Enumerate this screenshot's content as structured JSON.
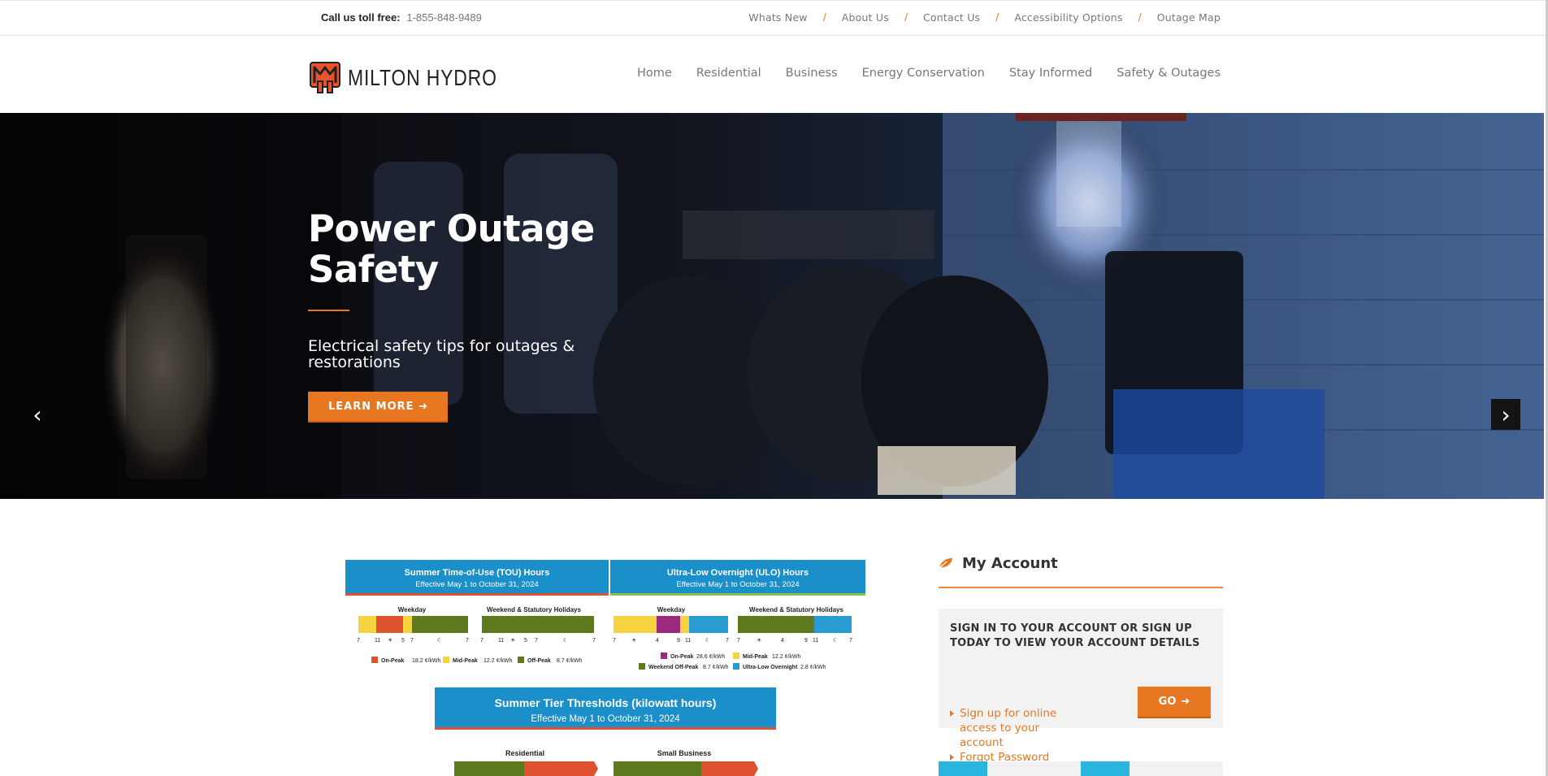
{
  "topbar": {
    "call_label": "Call us toll free:",
    "phone": "1-855-848-9489",
    "links": [
      "Whats New",
      "About Us",
      "Contact Us",
      "Accessibility Options",
      "Outage Map"
    ],
    "separator": "/"
  },
  "header": {
    "logo_text": "MILTON HYDRO",
    "nav": [
      "Home",
      "Residential",
      "Business",
      "Energy Conservation",
      "Stay Informed",
      "Safety & Outages"
    ]
  },
  "hero": {
    "title_line1": "Power Outage",
    "title_line2": "Safety",
    "subtitle": "Electrical safety tips for outages & restorations",
    "button_label": "LEARN MORE",
    "prev_icon": "‹",
    "next_icon": "›"
  },
  "rates": {
    "tou_title": "Summer Time-of-Use (TOU) Hours",
    "tou_sub": "Effective May 1 to October 31, 2024",
    "ulo_title": "Ultra-Low Overnight (ULO) Hours",
    "ulo_sub": "Effective May 1 to October 31, 2024",
    "weekday": "Weekday",
    "weekend": "Weekend & Statutory Holidays",
    "tou_legend": [
      {
        "label": "On-Peak",
        "price": "18.2 ¢/kWh",
        "color": "#e0512f"
      },
      {
        "label": "Mid-Peak",
        "price": "12.2 ¢/kWh",
        "color": "#f5d33f"
      },
      {
        "label": "Off-Peak",
        "price": "8.7 ¢/kWh",
        "color": "#5c7a1d"
      }
    ],
    "ulo_legend": [
      {
        "label": "On-Peak",
        "price": "28.6 ¢/kWh",
        "color": "#9b2a7d"
      },
      {
        "label": "Mid-Peak",
        "price": "12.2 ¢/kWh",
        "color": "#f5d33f"
      },
      {
        "label": "Weekend Off-Peak",
        "price": "8.7 ¢/kWh",
        "color": "#5c7a1d"
      },
      {
        "label": "Ultra-Low Overnight",
        "price": "2.8 ¢/kWh",
        "color": "#2a9bd1"
      }
    ],
    "tier_title": "Summer Tier Thresholds (kilowatt hours)",
    "tier_sub": "Effective May 1 to October 31, 2024",
    "tier_residential": "Residential",
    "tier_small_business": "Small Business"
  },
  "account": {
    "title": "My Account",
    "prompt": "SIGN IN TO YOUR ACCOUNT OR SIGN UP TODAY TO VIEW YOUR ACCOUNT DETAILS",
    "signup_link": "Sign up for online access to your account",
    "forgot_link": "Forgot Password",
    "go_label": "GO"
  },
  "colors": {
    "accent": "#e87722",
    "blue_banner": "#1a8fc9",
    "off_peak": "#5c7a1d"
  }
}
